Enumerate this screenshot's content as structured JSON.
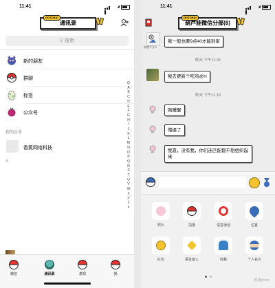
{
  "left": {
    "status_time": "11:41",
    "title": "通讯录",
    "title_tag": "GOTCHA!",
    "search_placeholder": "搜索",
    "items": [
      {
        "label": "新的朋友",
        "icon": "pokemon-new-friends-icon"
      },
      {
        "label": "群聊",
        "icon": "pokeball-group-icon"
      },
      {
        "label": "标签",
        "icon": "egg-tag-icon"
      },
      {
        "label": "公众号",
        "icon": "berry-official-icon"
      }
    ],
    "section_enterprise": "我的企业",
    "enterprise_item": "香蕉网络科技",
    "section_a": "A",
    "index_letters": [
      "Q",
      "A",
      "B",
      "C",
      "D",
      "E",
      "F",
      "G",
      "H",
      "I",
      "J",
      "K",
      "L",
      "M",
      "N",
      "O",
      "P",
      "Q",
      "R",
      "S",
      "T",
      "U",
      "V",
      "W",
      "X",
      "Y",
      "Z",
      "#"
    ],
    "tabs": [
      {
        "label": "微信"
      },
      {
        "label": "通讯录"
      },
      {
        "label": "发现"
      },
      {
        "label": "我"
      }
    ]
  },
  "right": {
    "status_time": "11:41",
    "title": "葫芦娃微信分部(8)",
    "title_tag": "GOTCHA!",
    "messages": [
      {
        "sender_tag": "你是个大人",
        "text": "我一般也要9点40才能到家"
      },
      {
        "time": "昨天 下午11:05"
      },
      {
        "text": "我去更新个吃鸡@H"
      },
      {
        "time": "昨天 下午11:18"
      },
      {
        "text": "刚睡醒"
      },
      {
        "text": "懵逼了"
      },
      {
        "text": "我靠，没有我，你们连匹配都不想组织起来"
      }
    ],
    "panel_items": [
      {
        "label": "照片",
        "icon": "photo-icon"
      },
      {
        "label": "拍摄",
        "icon": "camera-icon"
      },
      {
        "label": "语音通话",
        "icon": "voice-call-icon"
      },
      {
        "label": "位置",
        "icon": "location-icon"
      },
      {
        "label": "红包",
        "icon": "red-packet-icon"
      },
      {
        "label": "语音输入",
        "icon": "voice-input-icon"
      },
      {
        "label": "收藏",
        "icon": "favorites-icon"
      },
      {
        "label": "个人名片",
        "icon": "contact-card-icon"
      }
    ],
    "watermark": "苏驰photo"
  },
  "colors": {
    "accent_yellow": "#f4c430",
    "poke_red": "#e3342f",
    "poke_blue": "#3b6cb7"
  }
}
